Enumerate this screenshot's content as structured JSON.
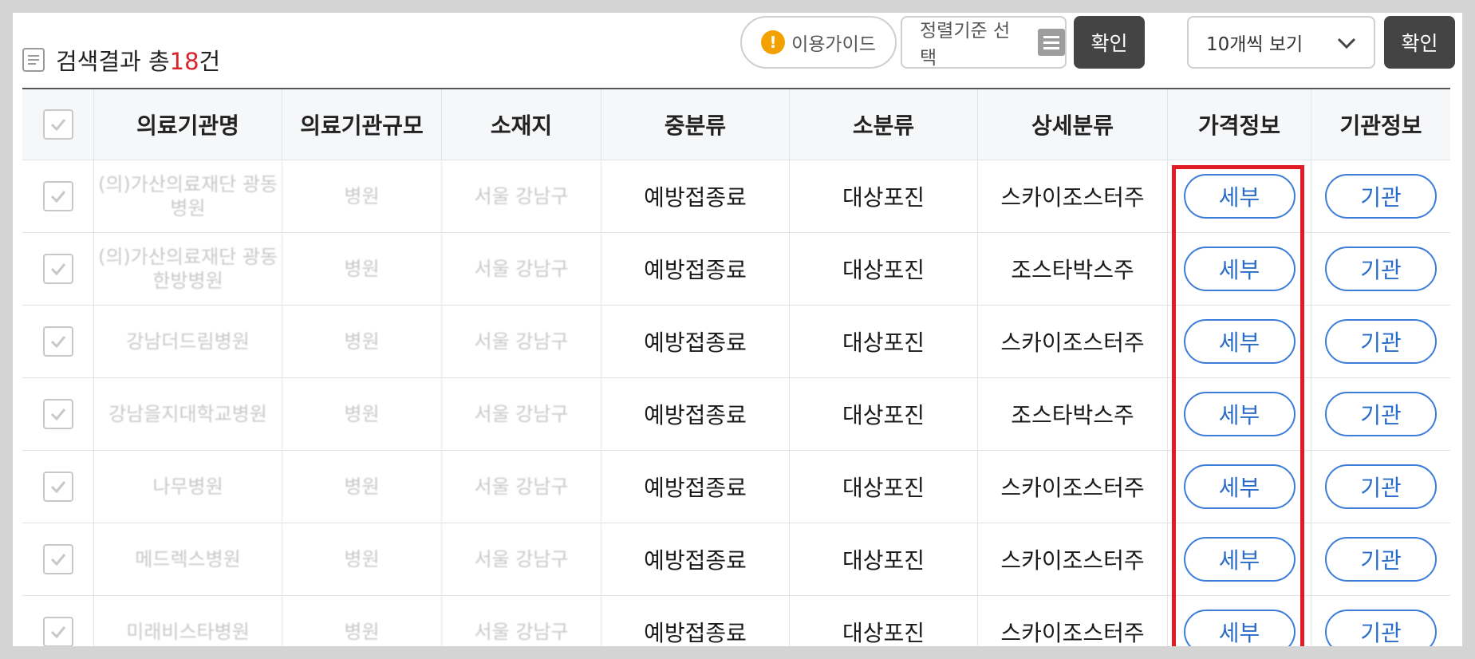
{
  "summary": {
    "label": "검색결과 총",
    "count": "18",
    "unit": "건"
  },
  "toolbar": {
    "guide_label": "이용가이드",
    "sort_placeholder": "정렬기준 선택",
    "confirm_label": "확인",
    "view_value": "10개씩 보기",
    "confirm_label_2": "확인"
  },
  "table": {
    "headers": [
      "의료기관명",
      "의료기관규모",
      "소재지",
      "중분류",
      "소분류",
      "상세분류",
      "가격정보",
      "기관정보"
    ],
    "rows": [
      {
        "name": "(의)가산의료재단 광동병원",
        "size": "병원",
        "location": "서울 강남구",
        "mid": "예방접종료",
        "sub": "대상포진",
        "detail": "스카이조스터주",
        "price_btn": "세부",
        "info_btn": "기관"
      },
      {
        "name": "(의)가산의료재단 광동한방병원",
        "size": "병원",
        "location": "서울 강남구",
        "mid": "예방접종료",
        "sub": "대상포진",
        "detail": "조스타박스주",
        "price_btn": "세부",
        "info_btn": "기관"
      },
      {
        "name": "강남더드림병원",
        "size": "병원",
        "location": "서울 강남구",
        "mid": "예방접종료",
        "sub": "대상포진",
        "detail": "스카이조스터주",
        "price_btn": "세부",
        "info_btn": "기관"
      },
      {
        "name": "강남을지대학교병원",
        "size": "병원",
        "location": "서울 강남구",
        "mid": "예방접종료",
        "sub": "대상포진",
        "detail": "조스타박스주",
        "price_btn": "세부",
        "info_btn": "기관"
      },
      {
        "name": "나무병원",
        "size": "병원",
        "location": "서울 강남구",
        "mid": "예방접종료",
        "sub": "대상포진",
        "detail": "스카이조스터주",
        "price_btn": "세부",
        "info_btn": "기관"
      },
      {
        "name": "메드렉스병원",
        "size": "병원",
        "location": "서울 강남구",
        "mid": "예방접종료",
        "sub": "대상포진",
        "detail": "스카이조스터주",
        "price_btn": "세부",
        "info_btn": "기관"
      },
      {
        "name": "미래비스타병원",
        "size": "병원",
        "location": "서울 강남구",
        "mid": "예방접종료",
        "sub": "대상포진",
        "detail": "스카이조스터주",
        "price_btn": "세부",
        "info_btn": "기관"
      }
    ]
  },
  "colors": {
    "accent_red": "#e01b24",
    "link_blue": "#2a6cc9",
    "count_red": "#d8232a"
  }
}
